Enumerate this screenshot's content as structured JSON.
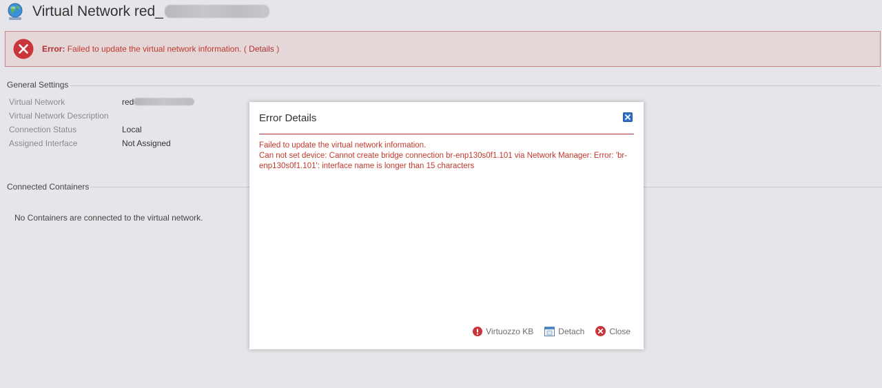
{
  "header": {
    "title": "Virtual Network red_"
  },
  "error_banner": {
    "label": "Error:",
    "message": "Failed to update the virtual network information. (",
    "details_link": "Details",
    "close_paren": ")"
  },
  "general_settings": {
    "heading": "General Settings",
    "rows": [
      {
        "label": "Virtual Network",
        "value": "red"
      },
      {
        "label": "Virtual Network Description",
        "value": ""
      },
      {
        "label": "Connection Status",
        "value": "Local"
      },
      {
        "label": "Assigned Interface",
        "value": "Not Assigned"
      }
    ]
  },
  "connected_containers": {
    "heading": "Connected Containers",
    "empty_message": "No Containers are connected to the virtual network."
  },
  "dialog": {
    "title": "Error Details",
    "line1": "Failed to update the virtual network information.",
    "line2": "Can not set device: Cannot create bridge connection br-enp130s0f1.101 via Network Manager: Error: 'br-enp130s0f1.101': interface name is longer than 15 characters",
    "buttons": {
      "kb": "Virtuozzo KB",
      "detach": "Detach",
      "close": "Close"
    }
  },
  "colors": {
    "error_red": "#c0392b",
    "banner_bg": "#e5d6d8",
    "page_bg": "#e6e6ea",
    "close_icon_blue": "#2f6fc4"
  },
  "icons": {
    "header": "globe-network-icon",
    "banner": "error-x-icon",
    "dialog_close": "close-icon",
    "kb": "exclamation-icon",
    "detach": "window-icon",
    "close": "close-circle-icon"
  }
}
